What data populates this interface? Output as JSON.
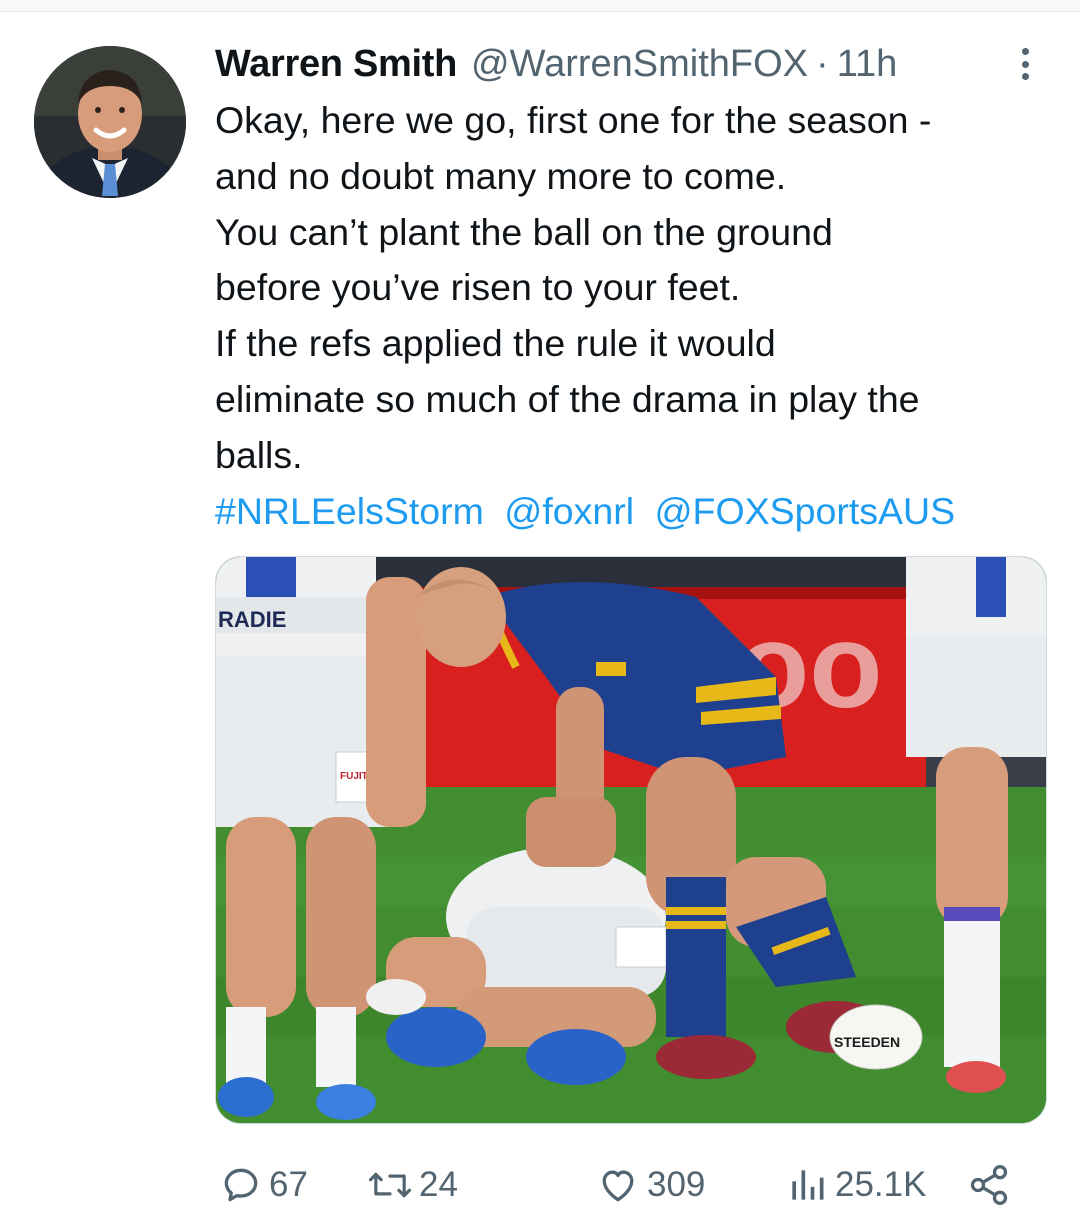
{
  "tweet": {
    "author_name": "Warren Smith",
    "author_handle": "@WarrenSmithFOX",
    "separator": "·",
    "time_ago": "11h",
    "lines": [
      "Okay, here we go, first one for the season -",
      "and no doubt many more to come.",
      "You can’t plant the ball on the ground",
      "before you’ve risen to your feet.",
      "If the refs applied the rule it would",
      "eliminate so much of the drama in play the",
      "balls."
    ],
    "links": [
      "#NRLEelsStorm",
      "@foxnrl",
      "@FOXSportsAUS"
    ]
  },
  "media": {
    "jersey_text": "RADIE",
    "sponsor_text": "FUJITSU",
    "ball_text": "STEEDEN",
    "colors": {
      "parra_blue": "#1f3f8f",
      "parra_gold": "#e6b818",
      "storm_white": "#eef0f2",
      "grass": "#3f8a2e",
      "signage_red": "#d8211f"
    }
  },
  "actions": {
    "replies": "67",
    "retweets": "24",
    "likes": "309",
    "views": "25.1K"
  },
  "icons": {
    "reply": "reply-icon",
    "retweet": "retweet-icon",
    "like": "heart-icon",
    "views": "views-icon",
    "share": "share-icon",
    "more": "more-icon"
  },
  "theme": {
    "accent": "#1d9bf0",
    "text": "#0f1419",
    "muted": "#536471"
  }
}
